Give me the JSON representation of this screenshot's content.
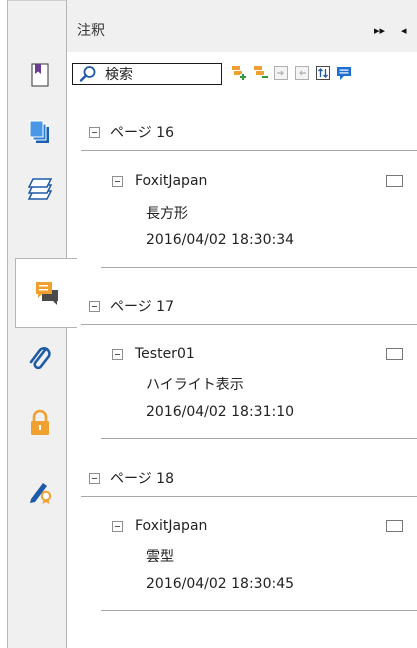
{
  "panel": {
    "title": "注釈",
    "header_buttons": [
      "▸▸",
      "◂"
    ]
  },
  "rail": {
    "items": [
      {
        "name": "page-thumbnails-icon",
        "active": false
      },
      {
        "name": "layers-pages-icon",
        "active": false
      },
      {
        "name": "layers-icon",
        "active": false
      },
      {
        "name": "comments-icon",
        "active": true
      },
      {
        "name": "attachment-icon",
        "active": false
      },
      {
        "name": "lock-icon",
        "active": false
      },
      {
        "name": "signature-icon",
        "active": false
      }
    ]
  },
  "toolbar": {
    "search_label": "検索",
    "buttons": [
      "expand-all-icon",
      "collapse-all-icon",
      "expand-icon",
      "collapse-icon",
      "sort-icon",
      "filter-comment-icon"
    ]
  },
  "colors": {
    "accent": "#f0a030",
    "blue": "#1e6fd0",
    "gray": "#4a4a4a"
  },
  "groups": [
    {
      "page": "ページ 16",
      "annotation": {
        "author": "FoxitJapan",
        "type": "長方形",
        "date": "2016/04/02 18:30:34"
      }
    },
    {
      "page": "ページ 17",
      "annotation": {
        "author": "Tester01",
        "type": "ハイライト表示",
        "date": "2016/04/02 18:31:10"
      }
    },
    {
      "page": "ページ 18",
      "annotation": {
        "author": "FoxitJapan",
        "type": "雲型",
        "date": "2016/04/02 18:30:45"
      }
    }
  ]
}
